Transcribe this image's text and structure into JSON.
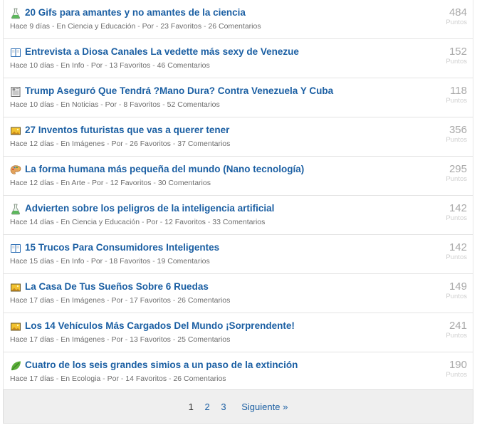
{
  "points_label": "Puntos",
  "posts": [
    {
      "icon": "flask-icon",
      "title": "20 Gifs para amantes y no amantes de la ciencia",
      "age": "Hace 9 días",
      "category": "En Ciencia y Educación",
      "author": "Por",
      "favorites": "23 Favoritos",
      "comments": "26 Comentarios",
      "points": "484"
    },
    {
      "icon": "book-icon",
      "title": "Entrevista a Diosa Canales La vedette más sexy de Venezue",
      "age": "Hace 10 días",
      "category": "En Info",
      "author": "Por",
      "favorites": "13 Favoritos",
      "comments": "46 Comentarios",
      "points": "152"
    },
    {
      "icon": "newspaper-icon",
      "title": "Trump Aseguró Que Tendrá ?Mano Dura? Contra Venezuela Y Cuba",
      "age": "Hace 10 días",
      "category": "En Noticias",
      "author": "Por",
      "favorites": "8 Favoritos",
      "comments": "52 Comentarios",
      "points": "118"
    },
    {
      "icon": "image-icon",
      "title": "27 Inventos futuristas que vas a querer tener",
      "age": "Hace 12 días",
      "category": "En Imágenes",
      "author": "Por",
      "favorites": "26 Favoritos",
      "comments": "37 Comentarios",
      "points": "356"
    },
    {
      "icon": "palette-icon",
      "title": "La forma humana más pequeña del mundo (Nano tecnología)",
      "age": "Hace 12 días",
      "category": "En Arte",
      "author": "Por",
      "favorites": "12 Favoritos",
      "comments": "30 Comentarios",
      "points": "295"
    },
    {
      "icon": "flask-icon",
      "title": "Advierten sobre los peligros de la inteligencia artificial",
      "age": "Hace 14 días",
      "category": "En Ciencia y Educación",
      "author": "Por",
      "favorites": "12 Favoritos",
      "comments": "33 Comentarios",
      "points": "142"
    },
    {
      "icon": "book-icon",
      "title": "15 Trucos Para Consumidores Inteligentes",
      "age": "Hace 15 días",
      "category": "En Info",
      "author": "Por",
      "favorites": "18 Favoritos",
      "comments": "19 Comentarios",
      "points": "142"
    },
    {
      "icon": "image-icon",
      "title": "La Casa De Tus Sueños Sobre 6 Ruedas",
      "age": "Hace 17 días",
      "category": "En Imágenes",
      "author": "Por",
      "favorites": "17 Favoritos",
      "comments": "26 Comentarios",
      "points": "149"
    },
    {
      "icon": "image-icon",
      "title": "Los 14 Vehículos Más Cargados Del Mundo ¡Sorprendente!",
      "age": "Hace 17 días",
      "category": "En Imágenes",
      "author": "Por",
      "favorites": "13 Favoritos",
      "comments": "25 Comentarios",
      "points": "241"
    },
    {
      "icon": "leaf-icon",
      "title": "Cuatro de los seis grandes simios a un paso de la extinción",
      "age": "Hace 17 días",
      "category": "En Ecologia",
      "author": "Por",
      "favorites": "14 Favoritos",
      "comments": "26 Comentarios",
      "points": "190"
    }
  ],
  "pagination": {
    "pages": [
      "1",
      "2",
      "3"
    ],
    "current": "1",
    "next_label": "Siguiente »"
  }
}
